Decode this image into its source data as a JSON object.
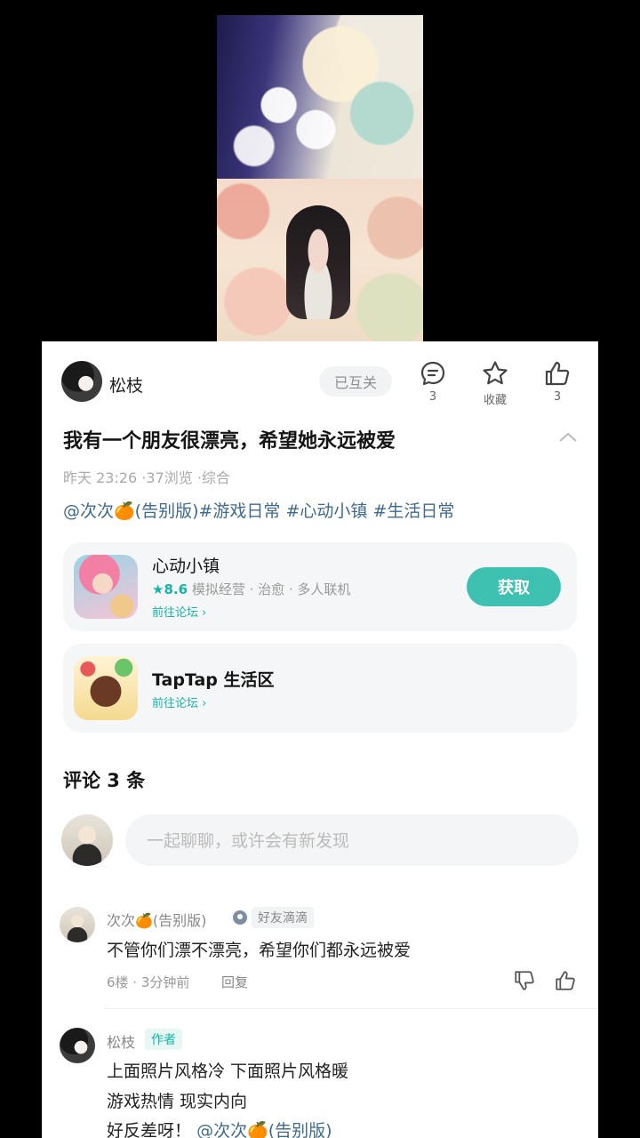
{
  "post": {
    "author": "松枝",
    "follow_label": "已互关",
    "actions": {
      "comment_count": "3",
      "favorite_label": "收藏",
      "like_count": "3"
    },
    "title": "我有一个朋友很漂亮，希望她永远被爱",
    "meta": {
      "time": "昨天 23:26",
      "views": "·37浏览",
      "category": "·综合"
    },
    "tags": "@次次🍊(告别版)#游戏日常 #心动小镇 #生活日常"
  },
  "cards": [
    {
      "title": "心动小镇",
      "rating": "★8.6",
      "genres": "模拟经营 · 治愈 · 多人联机",
      "link": "前往论坛 ›",
      "button": "获取"
    },
    {
      "title": "TapTap 生活区",
      "link": "前往论坛 ›"
    }
  ],
  "comments_section": {
    "title": "评论 3 条",
    "input_placeholder": "一起聊聊，或许会有新发现"
  },
  "comments": [
    {
      "user": "次次🍊(告别版)",
      "badge": "好友滴滴",
      "text": "不管你们漂不漂亮，希望你们都永远被爱",
      "meta": "6楼 · 3分钟前",
      "reply": "回复"
    },
    {
      "user": "松枝",
      "badge": "作者",
      "lines": [
        "上面照片风格冷 下面照片风格暖",
        "游戏热情 现实内向",
        "好反差呀！"
      ],
      "mention": "@次次🍊(告别版)"
    }
  ],
  "colors": {
    "accent": "#3ec1b0",
    "link": "#3e6a8f",
    "teal_text": "#17b5a5"
  },
  "icons": [
    "comment-icon",
    "star-icon",
    "thumbs-up-icon",
    "thumbs-down-icon",
    "chevron-up-icon"
  ]
}
